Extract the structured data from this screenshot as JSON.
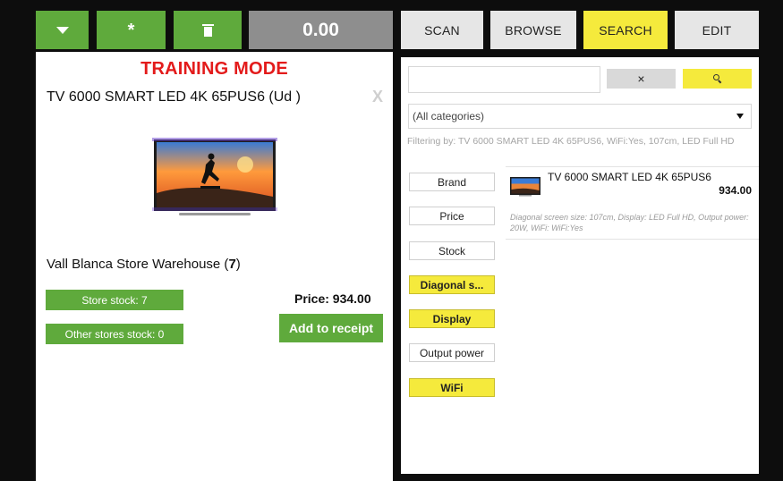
{
  "toolbar": {
    "dropdown_icon": "caret-down-icon",
    "star_icon": "asterisk-icon",
    "trash_icon": "trash-icon",
    "total": "0.00"
  },
  "left_panel": {
    "mode_banner": "TRAINING MODE",
    "product_title": "TV 6000 SMART LED 4K 65PUS6 (Ud )",
    "close_glyph": "X",
    "warehouse_name": "Vall Blanca Store Warehouse (",
    "warehouse_count": "7",
    "warehouse_close": ")",
    "store_stock": "Store stock: 7",
    "other_stock": "Other stores stock: 0",
    "price": "Price: 934.00",
    "add_button": "Add to receipt"
  },
  "tabs": [
    {
      "label": "SCAN",
      "active": false
    },
    {
      "label": "BROWSE",
      "active": false
    },
    {
      "label": "SEARCH",
      "active": true
    },
    {
      "label": "EDIT",
      "active": false
    }
  ],
  "search": {
    "query": "",
    "clear_glyph": "×",
    "search_icon": "search-icon",
    "category": "(All categories)",
    "filter_text": "Filtering by: TV 6000 SMART LED 4K 65PUS6, WiFi:Yes, 107cm, LED Full HD"
  },
  "facets": [
    {
      "label": "Brand",
      "active": false
    },
    {
      "label": "Price",
      "active": false
    },
    {
      "label": "Stock",
      "active": false
    },
    {
      "label": "Diagonal s...",
      "active": true
    },
    {
      "label": "Display",
      "active": true
    },
    {
      "label": "Output power",
      "active": false
    },
    {
      "label": "WiFi",
      "active": true
    }
  ],
  "result": {
    "name": "TV 6000 SMART LED 4K 65PUS6",
    "price": "934.00",
    "description": "Diagonal screen size: 107cm, Display: LED Full HD, Output power: 20W, WiFi: WiFi:Yes"
  },
  "colors": {
    "green": "#5faa3c",
    "yellow": "#f5ea3c",
    "red": "#e31b1b",
    "grey_total": "#8e8e8e"
  }
}
